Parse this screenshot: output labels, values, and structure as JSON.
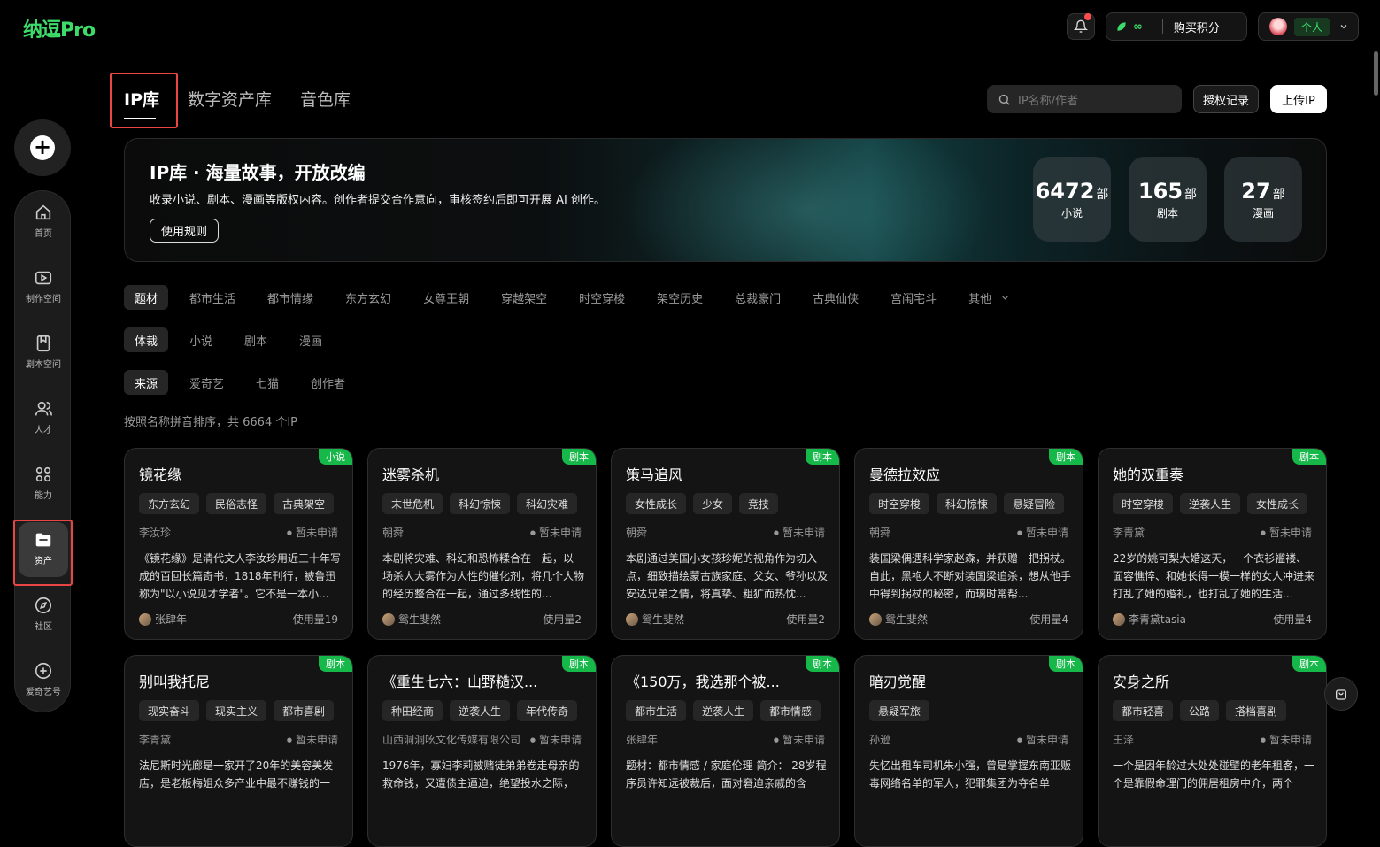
{
  "app": {
    "logo": "纳逗Pro"
  },
  "topbar": {
    "credits_value": "∞",
    "buy_label": "购买积分",
    "persona": "个人"
  },
  "sidebar": {
    "items": [
      {
        "label": "首页",
        "icon": "home-icon"
      },
      {
        "label": "制作空间",
        "icon": "studio-icon"
      },
      {
        "label": "剧本空间",
        "icon": "script-icon"
      },
      {
        "label": "人才",
        "icon": "talent-icon"
      },
      {
        "label": "能力",
        "icon": "apps-icon"
      },
      {
        "label": "资产",
        "icon": "folder-icon"
      },
      {
        "label": "社区",
        "icon": "compass-icon"
      },
      {
        "label": "爱奇艺号",
        "icon": "plus-circle-icon"
      }
    ]
  },
  "tabs": [
    {
      "label": "IP库"
    },
    {
      "label": "数字资产库"
    },
    {
      "label": "音色库"
    }
  ],
  "search": {
    "placeholder": "IP名称/作者"
  },
  "actions": {
    "records": "授权记录",
    "upload": "上传IP"
  },
  "banner": {
    "title": "IP库 · 海量故事，开放改编",
    "desc": "收录小说、剧本、漫画等版权内容。创作者提交合作意向，审核签约后即可开展 AI 创作。",
    "rule_button": "使用规则",
    "stats": [
      {
        "num": "6472",
        "unit": "部",
        "label": "小说"
      },
      {
        "num": "165",
        "unit": "部",
        "label": "剧本"
      },
      {
        "num": "27",
        "unit": "部",
        "label": "漫画"
      }
    ]
  },
  "filters": {
    "theme": {
      "label": "题材",
      "options": [
        "都市生活",
        "都市情缘",
        "东方玄幻",
        "女尊王朝",
        "穿越架空",
        "时空穿梭",
        "架空历史",
        "总裁豪门",
        "古典仙侠",
        "宫闱宅斗"
      ],
      "more": "其他"
    },
    "genre": {
      "label": "体裁",
      "options": [
        "小说",
        "剧本",
        "漫画"
      ]
    },
    "source": {
      "label": "来源",
      "options": [
        "爱奇艺",
        "七猫",
        "创作者"
      ]
    }
  },
  "sort_info": "按照名称拼音排序，共 6664 个IP",
  "cards": [
    {
      "badge": "小说",
      "title": "镜花缘",
      "tags": [
        "东方玄幻",
        "民俗志怪",
        "古典架空"
      ],
      "author": "李汝珍",
      "status": "暂未申请",
      "desc": "《镜花缘》是清代文人李汝珍用近三十年写成的百回长篇奇书，1818年刊行，被鲁迅称为\"以小说见才学者\"。它不是一本小...",
      "user": "张肆年",
      "usage": "使用量19"
    },
    {
      "badge": "剧本",
      "title": "迷雾杀机",
      "tags": [
        "末世危机",
        "科幻惊悚",
        "科幻灾难"
      ],
      "author": "朝舜",
      "status": "暂未申请",
      "desc": "本剧将灾难、科幻和恐怖糅合在一起，以一场杀人大雾作为人性的催化剂，将几个人物的经历整合在一起，通过多线性的...",
      "user": "鸳生斐然",
      "usage": "使用量2"
    },
    {
      "badge": "剧本",
      "title": "策马追风",
      "tags": [
        "女性成长",
        "少女",
        "竞技"
      ],
      "author": "朝舜",
      "status": "暂未申请",
      "desc": "本剧通过美国小女孩珍妮的视角作为切入点，细致描绘蒙古族家庭、父女、爷孙以及安达兄弟之情，将真挚、粗犷而热忱...",
      "user": "鸳生斐然",
      "usage": "使用量2"
    },
    {
      "badge": "剧本",
      "title": "曼德拉效应",
      "tags": [
        "时空穿梭",
        "科幻惊悚",
        "悬疑冒险"
      ],
      "author": "朝舜",
      "status": "暂未申请",
      "desc": "装国梁偶遇科学家赵森，并获赠一把拐杖。自此，黑袍人不断对装国梁追杀，想从他手中得到拐杖的秘密，而璃时常帮...",
      "user": "鸳生斐然",
      "usage": "使用量4"
    },
    {
      "badge": "剧本",
      "title": "她的双重奏",
      "tags": [
        "时空穿梭",
        "逆袭人生",
        "女性成长"
      ],
      "author": "李青黛",
      "status": "暂未申请",
      "desc": "22岁的姚可梨大婚这天，一个衣衫褴褛、面容憔悴、和她长得一模一样的女人冲进来打乱了她的婚礼，也打乱了她的生活...",
      "user": "李青黛tasia",
      "usage": "使用量4"
    },
    {
      "badge": "剧本",
      "title": "别叫我托尼",
      "tags": [
        "现实奋斗",
        "现实主义",
        "都市喜剧"
      ],
      "author": "李青黛",
      "status": "暂未申请",
      "desc": "法尼斯时光廊是一家开了20年的美容美发店，是老板梅姐众多产业中最不赚钱的一",
      "user": "",
      "usage": ""
    },
    {
      "badge": "剧本",
      "title": "《重生七六：山野糙汉...",
      "tags": [
        "种田经商",
        "逆袭人生",
        "年代传奇"
      ],
      "author": "山西洞洞吆文化传媒有限公司",
      "status": "暂未申请",
      "desc": "1976年，寡妇李莉被赌徒弟弟卷走母亲的救命钱，又遭债主逼迫，绝望投水之际，",
      "user": "",
      "usage": ""
    },
    {
      "badge": "剧本",
      "title": "《150万，我选那个被...",
      "tags": [
        "都市生活",
        "逆袭人生",
        "都市情感"
      ],
      "author": "张肆年",
      "status": "暂未申请",
      "desc": "题材：都市情感 / 家庭伦理 简介： 28岁程序员许知远被裁后，面对窘迫亲戚的含",
      "user": "",
      "usage": ""
    },
    {
      "badge": "剧本",
      "title": "暗刃觉醒",
      "tags": [
        "悬疑军旅"
      ],
      "author": "孙逊",
      "status": "暂未申请",
      "desc": "失忆出租车司机朱小强，曾是掌握东南亚贩毒网络名单的军人，犯罪集团为夺名单",
      "user": "",
      "usage": ""
    },
    {
      "badge": "剧本",
      "title": "安身之所",
      "tags": [
        "都市轻喜",
        "公路",
        "搭档喜剧"
      ],
      "author": "王泽",
      "status": "暂未申请",
      "desc": "一个是因年龄过大处处碰壁的老年租客，一个是靠假命理门的佣居租房中介，两个",
      "user": "",
      "usage": ""
    }
  ],
  "colors": {
    "accent": "#3ddc6a",
    "badge": "#17b84a",
    "highlight": "#e84545"
  }
}
